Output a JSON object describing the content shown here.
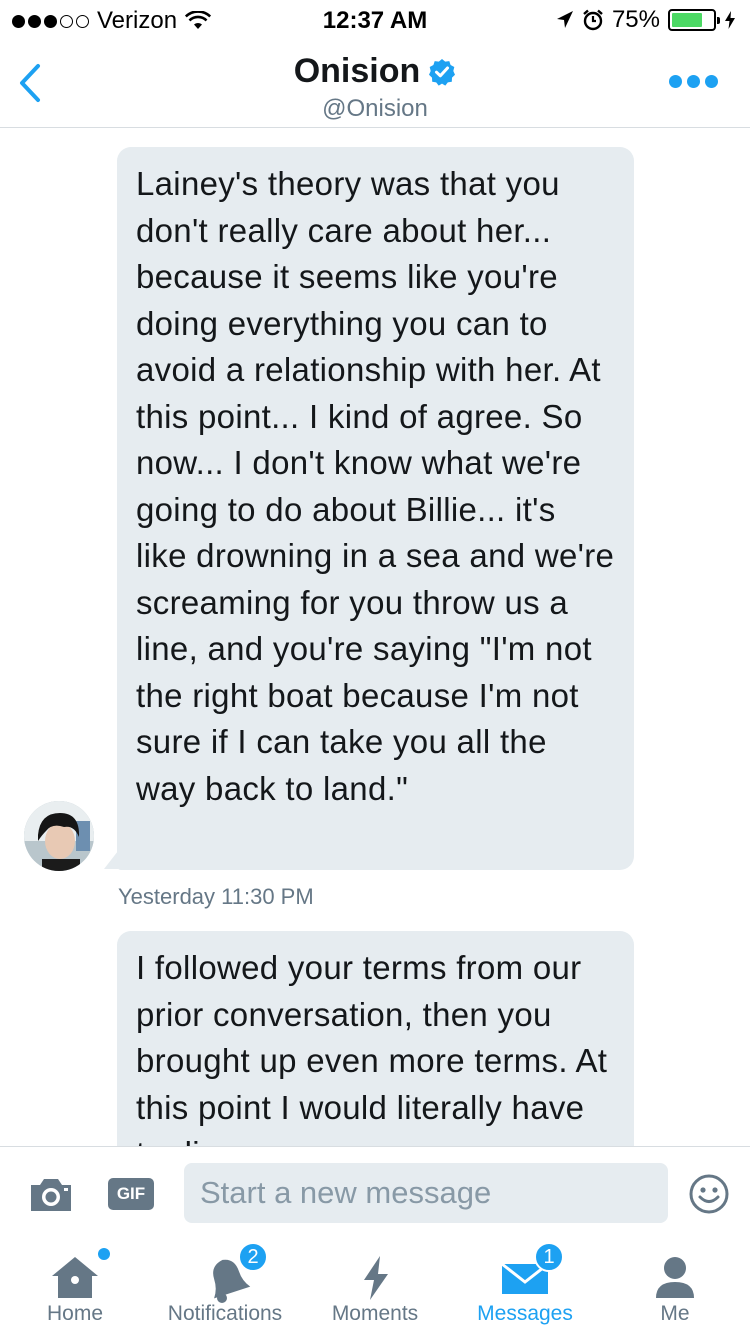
{
  "status_bar": {
    "carrier": "Verizon",
    "time": "12:37 AM",
    "battery_percent": "75%",
    "battery_level": 0.75
  },
  "header": {
    "name": "Onision",
    "handle": "@Onision",
    "verified": true
  },
  "messages": [
    {
      "text": "Lainey's theory was that you don't really care about her... because it seems like you're doing everything you can to avoid a relationship with her. At this point... I kind of agree. So now... I don't know what we're going to do about Billie... it's like drowning in a sea and we're screaming for you throw us a line, and you're saying \"I'm not the right boat because I'm not sure if I can take you all the way back to land.\"",
      "timestamp": "Yesterday 11:30 PM"
    },
    {
      "text": "I followed your terms from our prior conversation, then you brought up even more terms. At this point I would literally have to divorce"
    }
  ],
  "composer": {
    "gif_label": "GIF",
    "placeholder": "Start a new message"
  },
  "tabs": [
    {
      "label": "Home",
      "badge": ""
    },
    {
      "label": "Notifications",
      "badge": "2"
    },
    {
      "label": "Moments",
      "badge": ""
    },
    {
      "label": "Messages",
      "badge": "1"
    },
    {
      "label": "Me",
      "badge": ""
    }
  ],
  "colors": {
    "accent": "#1da1f2",
    "bubble": "#e6ecf0",
    "muted": "#657786",
    "battery": "#4cd964"
  },
  "icons": {
    "back": "chevron-left-icon",
    "verified": "verified-badge-icon",
    "more": "more-icon",
    "camera": "camera-icon",
    "emoji": "emoji-icon",
    "home": "home-icon",
    "notifications": "bell-icon",
    "moments": "lightning-icon",
    "messages": "envelope-icon",
    "me": "person-icon"
  }
}
